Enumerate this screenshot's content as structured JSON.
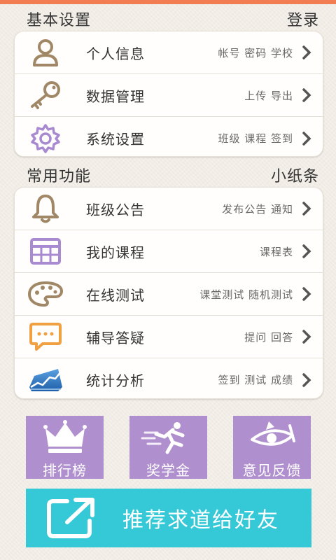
{
  "colors": {
    "accent_strip": "#f27d52",
    "tile_purple": "#b08fce",
    "share_cyan": "#35c9d8",
    "icon_brown": "#a08766",
    "icon_purple": "#a88ad0",
    "icon_orange": "#f0a040"
  },
  "basic": {
    "title": "基本设置",
    "action": "登录",
    "items": [
      {
        "icon": "user-icon",
        "label": "个人信息",
        "hint": "帐号 密码 学校"
      },
      {
        "icon": "key-icon",
        "label": "数据管理",
        "hint": "上传 导出"
      },
      {
        "icon": "gear-icon",
        "label": "系统设置",
        "hint": "班级 课程 签到"
      }
    ]
  },
  "common": {
    "title": "常用功能",
    "action": "小纸条",
    "items": [
      {
        "icon": "bell-icon",
        "label": "班级公告",
        "hint": "发布公告 通知"
      },
      {
        "icon": "calendar-icon",
        "label": "我的课程",
        "hint": "课程表"
      },
      {
        "icon": "palette-icon",
        "label": "在线测试",
        "hint": "课堂测试 随机测试"
      },
      {
        "icon": "chat-icon",
        "label": "辅导答疑",
        "hint": "提问 回答"
      },
      {
        "icon": "chart-icon",
        "label": "统计分析",
        "hint": "签到 测试 成绩"
      }
    ]
  },
  "tiles": [
    {
      "icon": "crown-icon",
      "label": "排行榜"
    },
    {
      "icon": "runner-icon",
      "label": "奖学金"
    },
    {
      "icon": "eye-icon",
      "label": "意见反馈"
    }
  ],
  "share": {
    "icon": "share-icon",
    "label": "推荐求道给好友"
  }
}
